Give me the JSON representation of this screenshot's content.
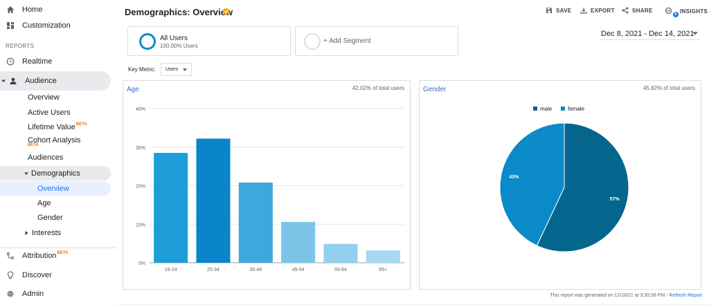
{
  "sidebar": {
    "home": "Home",
    "customization": "Customization",
    "reports_header": "REPORTS",
    "realtime": "Realtime",
    "audience": "Audience",
    "audience_items": {
      "overview": "Overview",
      "active_users": "Active Users",
      "lifetime_value": "Lifetime Value",
      "cohort_analysis": "Cohort Analysis",
      "audiences": "Audiences",
      "demographics": "Demographics",
      "demo_overview": "Overview",
      "age": "Age",
      "gender": "Gender",
      "interests": "Interests"
    },
    "beta_label": "BETA",
    "attribution": "Attribution",
    "discover": "Discover",
    "admin": "Admin"
  },
  "header": {
    "title": "Demographics: Overview",
    "save": "SAVE",
    "export": "EXPORT",
    "share": "SHARE",
    "insights": "INSIGHTS",
    "insights_badge": "5"
  },
  "segments": {
    "all_users": "All Users",
    "all_users_pct": "100.00% Users",
    "add_segment": "+ Add Segment",
    "date_range": "Dec 8, 2021 - Dec 14, 2021"
  },
  "key_metric": {
    "label": "Key Metric:",
    "value": "Users"
  },
  "age_panel": {
    "title": "Age",
    "stat": "42.02% of total users"
  },
  "gender_panel": {
    "title": "Gender",
    "stat": "45.82% of total users"
  },
  "chart_data": [
    {
      "type": "bar",
      "categories": [
        "18-24",
        "25-34",
        "35-44",
        "45-54",
        "55-64",
        "65+"
      ],
      "values": [
        28.5,
        32.2,
        20.8,
        10.6,
        4.9,
        3.2
      ],
      "colors": [
        "#1f9dd9",
        "#0a85c9",
        "#3da8dc",
        "#7cc5e8",
        "#93d0ef",
        "#a6d8f2"
      ],
      "yticks": [
        "0%",
        "10%",
        "20%",
        "30%",
        "40%"
      ],
      "ylim": [
        0,
        40
      ]
    },
    {
      "type": "pie",
      "labels": [
        "male",
        "female"
      ],
      "values": [
        57,
        43
      ],
      "display": [
        "57%",
        "43%"
      ],
      "colors": [
        "#05668d",
        "#0a8ac9"
      ]
    }
  ],
  "footer": {
    "note": "This report was generated on 12/16/21 at 3:35:56 PM - ",
    "refresh": "Refresh Report"
  }
}
